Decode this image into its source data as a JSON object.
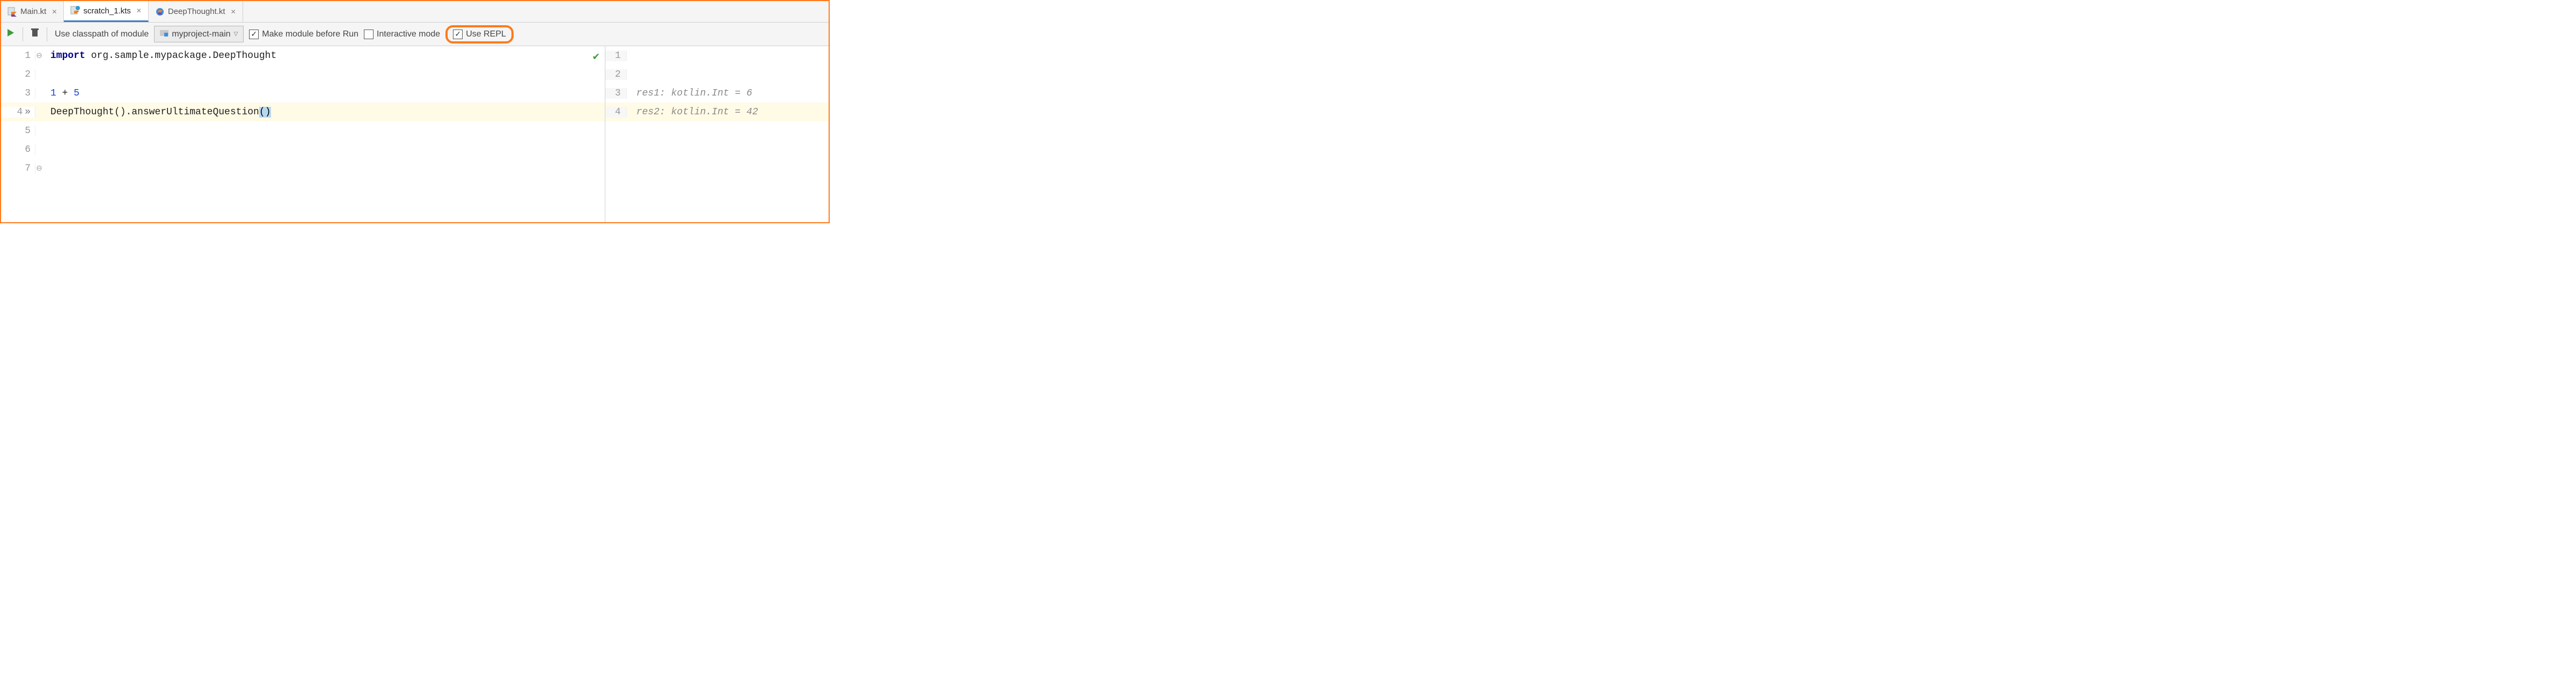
{
  "tabs": [
    {
      "name": "Main.kt",
      "active": false,
      "icon": "kotlin-class"
    },
    {
      "name": "scratch_1.kts",
      "active": true,
      "icon": "kotlin-scratch"
    },
    {
      "name": "DeepThought.kt",
      "active": false,
      "icon": "kotlin-class-blue"
    }
  ],
  "toolbar": {
    "classpath_label": "Use classpath of module",
    "module_name": "myproject-main",
    "make_module_label": "Make module before Run",
    "make_module_checked": true,
    "interactive_label": "Interactive mode",
    "interactive_checked": false,
    "use_repl_label": "Use REPL",
    "use_repl_checked": true
  },
  "editor": {
    "lines": [
      {
        "n": 1,
        "tokens": [
          [
            "kw",
            "import"
          ],
          [
            "txt",
            " org.sample.mypackage.DeepThought"
          ]
        ],
        "fold": "open"
      },
      {
        "n": 2,
        "tokens": []
      },
      {
        "n": 3,
        "tokens": [
          [
            "num",
            "1"
          ],
          [
            "txt",
            " + "
          ],
          [
            "num",
            "5"
          ]
        ]
      },
      {
        "n": 4,
        "tokens": [
          [
            "txt",
            "DeepThought().answerUltimateQuestion"
          ],
          [
            "paren",
            "("
          ],
          [
            "paren",
            ")"
          ]
        ],
        "current": true,
        "exec": true
      },
      {
        "n": 5,
        "tokens": []
      },
      {
        "n": 6,
        "tokens": []
      },
      {
        "n": 7,
        "tokens": [],
        "fold": "close"
      }
    ],
    "checkmark": true
  },
  "results": {
    "lines": [
      {
        "n": 1,
        "text": ""
      },
      {
        "n": 2,
        "text": ""
      },
      {
        "n": 3,
        "text": "res1: kotlin.Int = 6"
      },
      {
        "n": 4,
        "text": "res2: kotlin.Int = 42",
        "current": true
      }
    ]
  }
}
